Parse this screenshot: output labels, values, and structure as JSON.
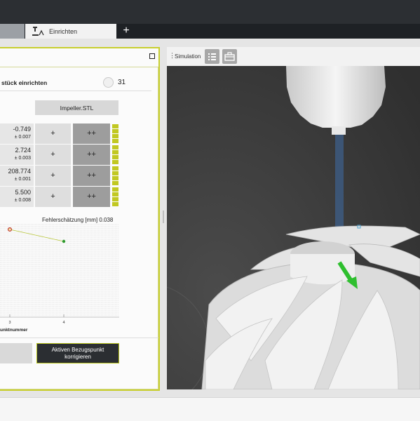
{
  "tabs": {
    "active_label": "Einrichten",
    "add_label": "+"
  },
  "panel": {
    "title": "stück einrichten",
    "count": "31",
    "model_button": "Impeller.STL",
    "rows": [
      {
        "value": "-0.749",
        "tolerance": "± 0.007",
        "plus": "+",
        "plusplus": "++"
      },
      {
        "value": "2.724",
        "tolerance": "± 0.003",
        "plus": "+",
        "plusplus": "++"
      },
      {
        "value": "208.774",
        "tolerance": "± 0.001",
        "plus": "+",
        "plusplus": "++"
      },
      {
        "value": "5.500",
        "tolerance": "± 0.008",
        "plus": "+",
        "plusplus": "++"
      }
    ],
    "apply_line1": "Aktiven Bezugspunkt",
    "apply_line2": "korrigieren"
  },
  "chart_data": {
    "type": "line",
    "title": "Fehlerschätzung [mm] 0.038",
    "xlabel": "unktnummer",
    "x_ticks": [
      "3",
      "4"
    ],
    "series": [
      {
        "x": [
          3,
          4
        ],
        "y": [
          0.038,
          0.03
        ]
      }
    ],
    "colors": {
      "line": "#b8c63a",
      "first_point": "#c0392b",
      "second_point": "#2e9a2e"
    }
  },
  "simulation": {
    "label": "Simulation",
    "icons": [
      "list-icon",
      "toolbox-icon"
    ]
  }
}
